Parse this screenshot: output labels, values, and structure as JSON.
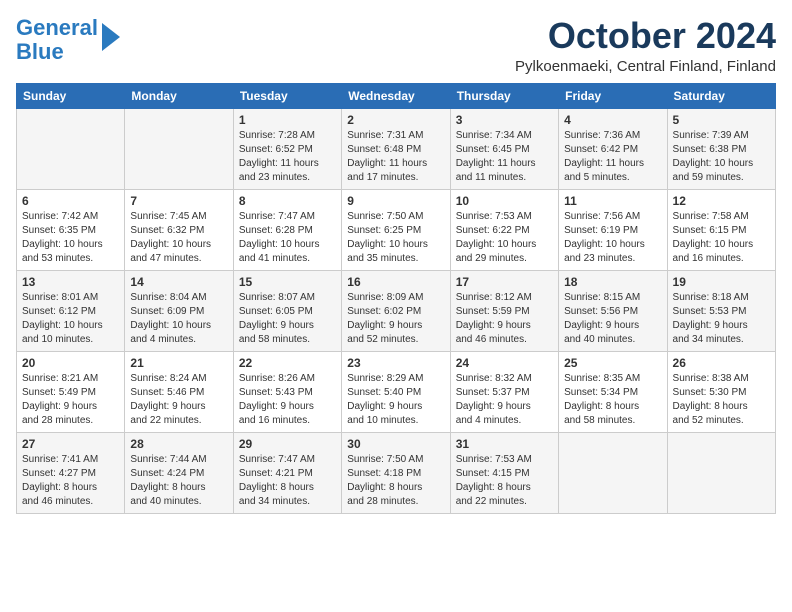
{
  "logo": {
    "line1": "General",
    "line2": "Blue"
  },
  "title": "October 2024",
  "location": "Pylkoenmaeki, Central Finland, Finland",
  "headers": [
    "Sunday",
    "Monday",
    "Tuesday",
    "Wednesday",
    "Thursday",
    "Friday",
    "Saturday"
  ],
  "weeks": [
    [
      {
        "day": "",
        "info": ""
      },
      {
        "day": "",
        "info": ""
      },
      {
        "day": "1",
        "info": "Sunrise: 7:28 AM\nSunset: 6:52 PM\nDaylight: 11 hours\nand 23 minutes."
      },
      {
        "day": "2",
        "info": "Sunrise: 7:31 AM\nSunset: 6:48 PM\nDaylight: 11 hours\nand 17 minutes."
      },
      {
        "day": "3",
        "info": "Sunrise: 7:34 AM\nSunset: 6:45 PM\nDaylight: 11 hours\nand 11 minutes."
      },
      {
        "day": "4",
        "info": "Sunrise: 7:36 AM\nSunset: 6:42 PM\nDaylight: 11 hours\nand 5 minutes."
      },
      {
        "day": "5",
        "info": "Sunrise: 7:39 AM\nSunset: 6:38 PM\nDaylight: 10 hours\nand 59 minutes."
      }
    ],
    [
      {
        "day": "6",
        "info": "Sunrise: 7:42 AM\nSunset: 6:35 PM\nDaylight: 10 hours\nand 53 minutes."
      },
      {
        "day": "7",
        "info": "Sunrise: 7:45 AM\nSunset: 6:32 PM\nDaylight: 10 hours\nand 47 minutes."
      },
      {
        "day": "8",
        "info": "Sunrise: 7:47 AM\nSunset: 6:28 PM\nDaylight: 10 hours\nand 41 minutes."
      },
      {
        "day": "9",
        "info": "Sunrise: 7:50 AM\nSunset: 6:25 PM\nDaylight: 10 hours\nand 35 minutes."
      },
      {
        "day": "10",
        "info": "Sunrise: 7:53 AM\nSunset: 6:22 PM\nDaylight: 10 hours\nand 29 minutes."
      },
      {
        "day": "11",
        "info": "Sunrise: 7:56 AM\nSunset: 6:19 PM\nDaylight: 10 hours\nand 23 minutes."
      },
      {
        "day": "12",
        "info": "Sunrise: 7:58 AM\nSunset: 6:15 PM\nDaylight: 10 hours\nand 16 minutes."
      }
    ],
    [
      {
        "day": "13",
        "info": "Sunrise: 8:01 AM\nSunset: 6:12 PM\nDaylight: 10 hours\nand 10 minutes."
      },
      {
        "day": "14",
        "info": "Sunrise: 8:04 AM\nSunset: 6:09 PM\nDaylight: 10 hours\nand 4 minutes."
      },
      {
        "day": "15",
        "info": "Sunrise: 8:07 AM\nSunset: 6:05 PM\nDaylight: 9 hours\nand 58 minutes."
      },
      {
        "day": "16",
        "info": "Sunrise: 8:09 AM\nSunset: 6:02 PM\nDaylight: 9 hours\nand 52 minutes."
      },
      {
        "day": "17",
        "info": "Sunrise: 8:12 AM\nSunset: 5:59 PM\nDaylight: 9 hours\nand 46 minutes."
      },
      {
        "day": "18",
        "info": "Sunrise: 8:15 AM\nSunset: 5:56 PM\nDaylight: 9 hours\nand 40 minutes."
      },
      {
        "day": "19",
        "info": "Sunrise: 8:18 AM\nSunset: 5:53 PM\nDaylight: 9 hours\nand 34 minutes."
      }
    ],
    [
      {
        "day": "20",
        "info": "Sunrise: 8:21 AM\nSunset: 5:49 PM\nDaylight: 9 hours\nand 28 minutes."
      },
      {
        "day": "21",
        "info": "Sunrise: 8:24 AM\nSunset: 5:46 PM\nDaylight: 9 hours\nand 22 minutes."
      },
      {
        "day": "22",
        "info": "Sunrise: 8:26 AM\nSunset: 5:43 PM\nDaylight: 9 hours\nand 16 minutes."
      },
      {
        "day": "23",
        "info": "Sunrise: 8:29 AM\nSunset: 5:40 PM\nDaylight: 9 hours\nand 10 minutes."
      },
      {
        "day": "24",
        "info": "Sunrise: 8:32 AM\nSunset: 5:37 PM\nDaylight: 9 hours\nand 4 minutes."
      },
      {
        "day": "25",
        "info": "Sunrise: 8:35 AM\nSunset: 5:34 PM\nDaylight: 8 hours\nand 58 minutes."
      },
      {
        "day": "26",
        "info": "Sunrise: 8:38 AM\nSunset: 5:30 PM\nDaylight: 8 hours\nand 52 minutes."
      }
    ],
    [
      {
        "day": "27",
        "info": "Sunrise: 7:41 AM\nSunset: 4:27 PM\nDaylight: 8 hours\nand 46 minutes."
      },
      {
        "day": "28",
        "info": "Sunrise: 7:44 AM\nSunset: 4:24 PM\nDaylight: 8 hours\nand 40 minutes."
      },
      {
        "day": "29",
        "info": "Sunrise: 7:47 AM\nSunset: 4:21 PM\nDaylight: 8 hours\nand 34 minutes."
      },
      {
        "day": "30",
        "info": "Sunrise: 7:50 AM\nSunset: 4:18 PM\nDaylight: 8 hours\nand 28 minutes."
      },
      {
        "day": "31",
        "info": "Sunrise: 7:53 AM\nSunset: 4:15 PM\nDaylight: 8 hours\nand 22 minutes."
      },
      {
        "day": "",
        "info": ""
      },
      {
        "day": "",
        "info": ""
      }
    ]
  ]
}
